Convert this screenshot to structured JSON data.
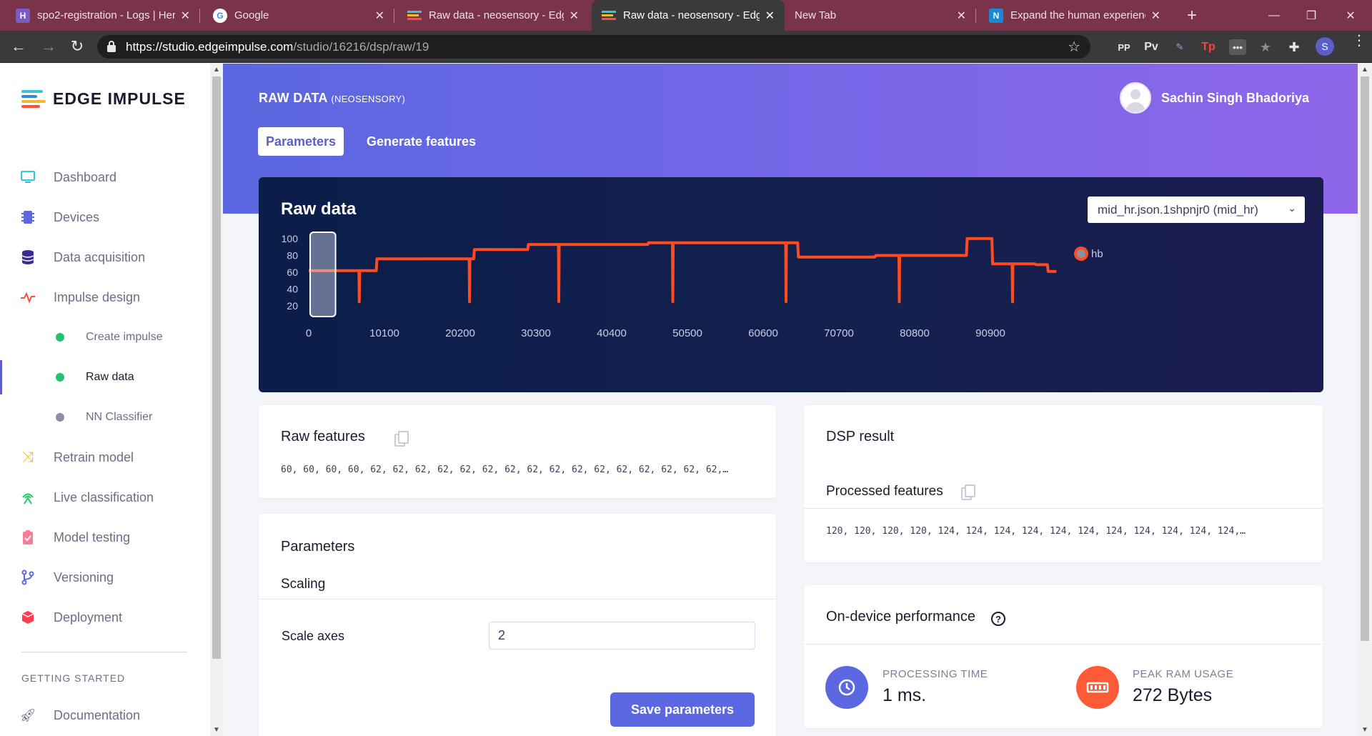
{
  "browser": {
    "tabs": [
      {
        "title": "spo2-registration - Logs | Her",
        "favicon": "heroku-icon",
        "active": false
      },
      {
        "title": "Google",
        "favicon": "google-icon",
        "active": false
      },
      {
        "title": "Raw data - neosensory - Edg",
        "favicon": "edge-impulse-icon",
        "active": false
      },
      {
        "title": "Raw data - neosensory - Edg",
        "favicon": "edge-impulse-icon",
        "active": true
      },
      {
        "title": "New Tab",
        "favicon": "",
        "active": false
      },
      {
        "title": "Expand the human experienc",
        "favicon": "neosensory-icon",
        "active": false
      }
    ],
    "url_host": "https://studio.edgeimpulse.com",
    "url_path": "/studio/16216/dsp/raw/19",
    "extensions": [
      "PP",
      "Pv",
      "Tp"
    ],
    "profile_initial": "S"
  },
  "sidebar": {
    "brand": "EDGE IMPULSE",
    "items": [
      {
        "label": "Dashboard",
        "icon": "monitor-icon"
      },
      {
        "label": "Devices",
        "icon": "chip-icon"
      },
      {
        "label": "Data acquisition",
        "icon": "database-icon"
      },
      {
        "label": "Impulse design",
        "icon": "pulse-icon"
      }
    ],
    "sub_items": [
      {
        "label": "Create impulse",
        "status_color": "#21c46c"
      },
      {
        "label": "Raw data",
        "status_color": "#21c46c",
        "active": true
      },
      {
        "label": "NN Classifier",
        "status_color": "#8a8fa3"
      }
    ],
    "items_after": [
      {
        "label": "Retrain model",
        "icon": "shuffle-icon"
      },
      {
        "label": "Live classification",
        "icon": "wifi-tower-icon"
      },
      {
        "label": "Model testing",
        "icon": "clipboard-check-icon"
      },
      {
        "label": "Versioning",
        "icon": "git-branch-icon"
      },
      {
        "label": "Deployment",
        "icon": "cube-icon"
      }
    ],
    "section_label": "GETTING STARTED",
    "section_items": [
      {
        "label": "Documentation",
        "icon": "rocket-icon"
      }
    ]
  },
  "header": {
    "title": "RAW DATA",
    "project": "(NEOSENSORY)",
    "user_name": "Sachin Singh Bhadoriya",
    "tabs": [
      "Parameters",
      "Generate features"
    ],
    "active_tab": "Parameters"
  },
  "raw_data": {
    "title": "Raw data",
    "selected_sample": "mid_hr.json.1shpnjr0 (mid_hr)"
  },
  "chart_data": {
    "type": "line",
    "xlim": [
      0,
      101000
    ],
    "ylim": [
      10,
      105
    ],
    "y_ticks": [
      100,
      80,
      60,
      40,
      20
    ],
    "x_ticks": [
      0,
      10100,
      20200,
      30300,
      40400,
      50500,
      60600,
      70700,
      80800,
      90900
    ],
    "series": [
      {
        "name": "hb",
        "color": "#ff4b1f",
        "points": [
          [
            0,
            62
          ],
          [
            6700,
            62
          ],
          [
            6750,
            25
          ],
          [
            6800,
            62
          ],
          [
            9000,
            62
          ],
          [
            9100,
            76
          ],
          [
            21400,
            76
          ],
          [
            21450,
            25
          ],
          [
            21500,
            76
          ],
          [
            22000,
            76
          ],
          [
            22100,
            87
          ],
          [
            29200,
            87
          ],
          [
            29300,
            93
          ],
          [
            33300,
            93
          ],
          [
            33350,
            25
          ],
          [
            33400,
            93
          ],
          [
            45200,
            93
          ],
          [
            45300,
            95
          ],
          [
            48500,
            95
          ],
          [
            48550,
            25
          ],
          [
            48600,
            95
          ],
          [
            63600,
            95
          ],
          [
            63650,
            25
          ],
          [
            63700,
            95
          ],
          [
            65200,
            95
          ],
          [
            65300,
            78
          ],
          [
            75500,
            78
          ],
          [
            75600,
            80
          ],
          [
            78700,
            80
          ],
          [
            78750,
            25
          ],
          [
            78800,
            80
          ],
          [
            87700,
            80
          ],
          [
            87800,
            100
          ],
          [
            91100,
            100
          ],
          [
            91200,
            70
          ],
          [
            93800,
            70
          ],
          [
            93850,
            25
          ],
          [
            93900,
            70
          ],
          [
            96800,
            70
          ],
          [
            97000,
            69
          ],
          [
            98500,
            69
          ],
          [
            98600,
            61
          ],
          [
            99700,
            61
          ]
        ]
      }
    ],
    "window": {
      "x_start": 0,
      "x_end": 3200
    }
  },
  "raw_features": {
    "title": "Raw features",
    "values": "60, 60, 60, 60, 62, 62, 62, 62, 62, 62, 62, 62, 62, 62, 62, 62, 62, 62, 62, 62,…"
  },
  "parameters": {
    "title": "Parameters",
    "section": "Scaling",
    "scale_axes_label": "Scale axes",
    "scale_axes_value": "2",
    "save_label": "Save parameters"
  },
  "dsp_result": {
    "title": "DSP result",
    "processed_label": "Processed features",
    "values": "120, 120, 120, 120, 124, 124, 124, 124, 124, 124, 124, 124, 124, 124, 124,…"
  },
  "performance": {
    "title": "On-device performance",
    "processing_label": "PROCESSING TIME",
    "processing_value": "1 ms.",
    "ram_label": "PEAK RAM USAGE",
    "ram_value": "272 Bytes",
    "processing_color": "#5b68e2",
    "ram_color": "#ff5a36"
  }
}
